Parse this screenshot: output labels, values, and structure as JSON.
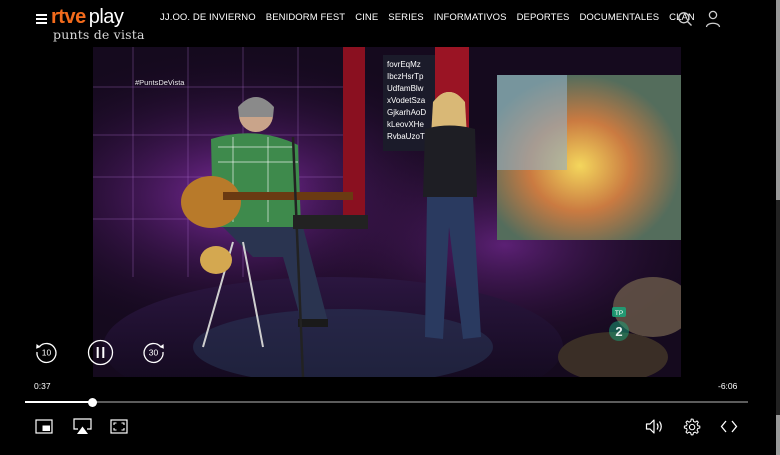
{
  "header": {
    "logo": {
      "brand": "rtve",
      "product": "play",
      "subtitle": "punts de vista"
    },
    "nav": [
      {
        "label": "JJ.OO. DE INVIERNO"
      },
      {
        "label": "BENIDORM FEST"
      },
      {
        "label": "CINE"
      },
      {
        "label": "SERIES"
      },
      {
        "label": "INFORMATIVOS"
      },
      {
        "label": "DEPORTES"
      },
      {
        "label": "DOCUMENTALES"
      },
      {
        "label": "CLAN"
      }
    ],
    "icons": {
      "menu": "menu-icon",
      "search": "search-icon",
      "user": "user-icon"
    }
  },
  "video": {
    "hashtag": "#PuntsDeVista",
    "channel_mark": "2",
    "channel_badge": "TP"
  },
  "player": {
    "current_time": "0:37",
    "remaining_time": "-6:06",
    "progress_fraction": 0.094,
    "rewind_seconds": "10",
    "forward_seconds": "30",
    "state": "playing"
  },
  "colors": {
    "brand_orange": "#f36b1c",
    "background": "#000000"
  }
}
